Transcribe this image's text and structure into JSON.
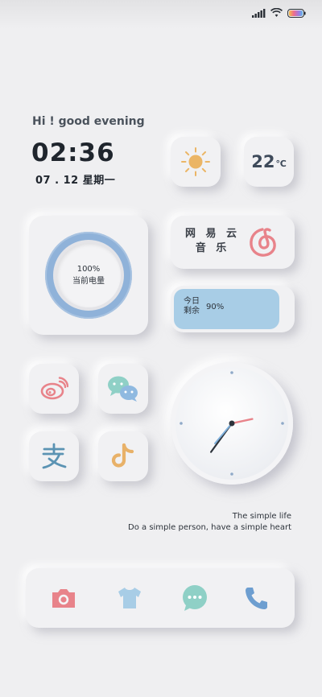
{
  "greeting": "Hi ! good evening",
  "clock": {
    "time": "02:36",
    "date": "07 . 12  星期一"
  },
  "weather": {
    "icon": "sun-icon",
    "temperature": "22",
    "unit": "℃"
  },
  "battery": {
    "percent": "100%",
    "label": "当前电量",
    "level": 1.0
  },
  "music": {
    "name_line1": "网 易 云",
    "name_line2": "音 乐",
    "icon": "netease-music-icon",
    "icon_color": "#e8838a"
  },
  "storage": {
    "label_line1": "今日",
    "label_line2": "剩余",
    "value": "90%",
    "level": 0.9
  },
  "apps": [
    {
      "name": "weibo",
      "icon": "weibo-icon",
      "color": "#e8838a"
    },
    {
      "name": "wechat",
      "icon": "wechat-icon",
      "color": "#7fc8c5"
    },
    {
      "name": "alipay",
      "icon": "alipay-icon",
      "color": "#5b93b3"
    },
    {
      "name": "douyin",
      "icon": "douyin-icon",
      "color": "#e8b168"
    }
  ],
  "analog_clock": {
    "hour": 2,
    "minute": 36
  },
  "quote": {
    "line1": "The simple life",
    "line2": "Do a simple person, have a simple heart"
  },
  "dock": [
    {
      "name": "camera",
      "icon": "camera-icon",
      "color": "#e8838a"
    },
    {
      "name": "theme",
      "icon": "shirt-icon",
      "color": "#a8cde6"
    },
    {
      "name": "messages",
      "icon": "message-icon",
      "color": "#7fc8c5"
    },
    {
      "name": "phone",
      "icon": "phone-icon",
      "color": "#6d9ed0"
    }
  ]
}
